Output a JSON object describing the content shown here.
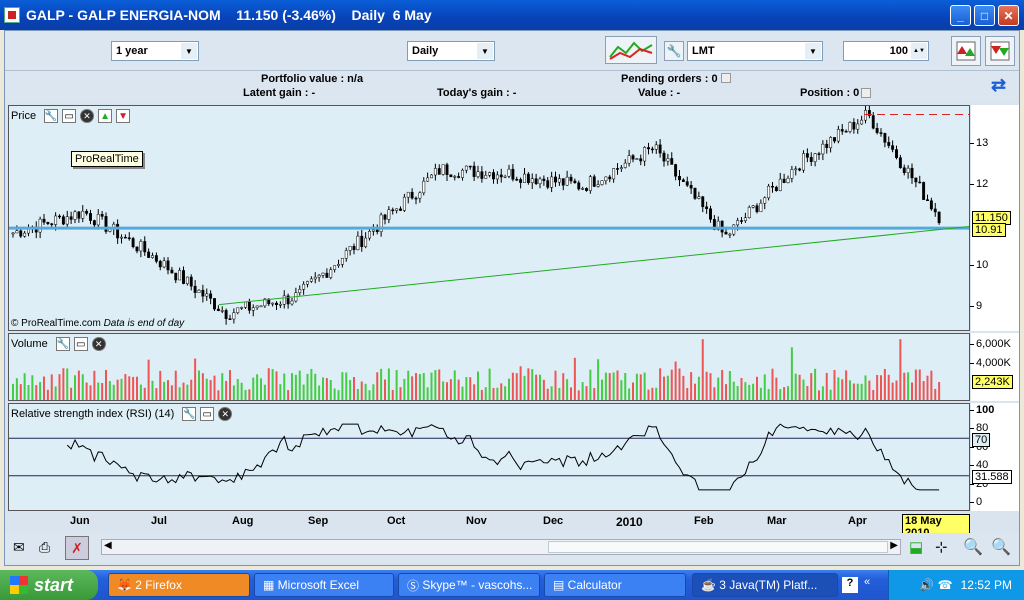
{
  "window": {
    "title": "GALP - GALP ENERGIA-NOM    11.150 (-3.46%)    Daily  6 May",
    "minimize": "_",
    "maximize": "□",
    "close": "✕"
  },
  "toolbar": {
    "period": "1 year",
    "interval": "Daily",
    "order_type": "LMT",
    "quantity": "100"
  },
  "info": {
    "portfolio": "Portfolio value : n/a",
    "pending": "Pending orders : 0",
    "latent": "Latent gain : -",
    "today": "Today's gain : -",
    "value": "Value : -",
    "position": "Position : 0"
  },
  "price_panel": {
    "title": "Price",
    "tooltip": "ProRealTime",
    "credit": "© ProRealTime.com",
    "note": "Data is end of day",
    "last_badge": "11.150",
    "line_badge": "10.91"
  },
  "volume_panel": {
    "title": "Volume",
    "badge": "2,243K"
  },
  "rsi_panel": {
    "title": "Relative strength index (RSI) (14)",
    "badge_70": "70",
    "badge_val": "31.588"
  },
  "time_axis": {
    "labels": [
      "Jun",
      "Jul",
      "Aug",
      "Sep",
      "Oct",
      "Nov",
      "Dec",
      "2010",
      "Feb",
      "Mar",
      "Apr"
    ],
    "date_badge": "18 May 2010"
  },
  "taskbar": {
    "start": "start",
    "tasks": [
      "2 Firefox",
      "Microsoft Excel",
      "Skype™ - vascohs...",
      "Calculator",
      "3 Java(TM) Platf..."
    ],
    "clock": "12:52 PM"
  },
  "chart_data": [
    {
      "type": "line",
      "title": "Price",
      "y_ticks": [
        13,
        12,
        10,
        9
      ],
      "ylim": [
        8.5,
        13.8
      ],
      "x": [
        "May",
        "Jun",
        "Jul",
        "Aug",
        "Sep",
        "Oct",
        "Nov",
        "Dec",
        "2010",
        "Feb",
        "Mar",
        "Apr",
        "May"
      ],
      "series": [
        {
          "values": [
            10.8,
            11.3,
            10.2,
            8.9,
            9.3,
            10.8,
            12.3,
            12.2,
            11.9,
            12.8,
            10.7,
            12.4,
            13.6,
            11.2
          ]
        }
      ],
      "horizontal_line": 10.91,
      "last_value": 11.15
    },
    {
      "type": "bar",
      "title": "Volume",
      "y_ticks": [
        "6,000K",
        "4,000K"
      ],
      "last_value": "2,243K"
    },
    {
      "type": "line",
      "title": "Relative strength index (RSI) (14)",
      "y_ticks": [
        100,
        80,
        60,
        40,
        20,
        0
      ],
      "ylim": [
        0,
        100
      ],
      "reference_lines": [
        70,
        30
      ],
      "last_value": 31.588
    }
  ]
}
